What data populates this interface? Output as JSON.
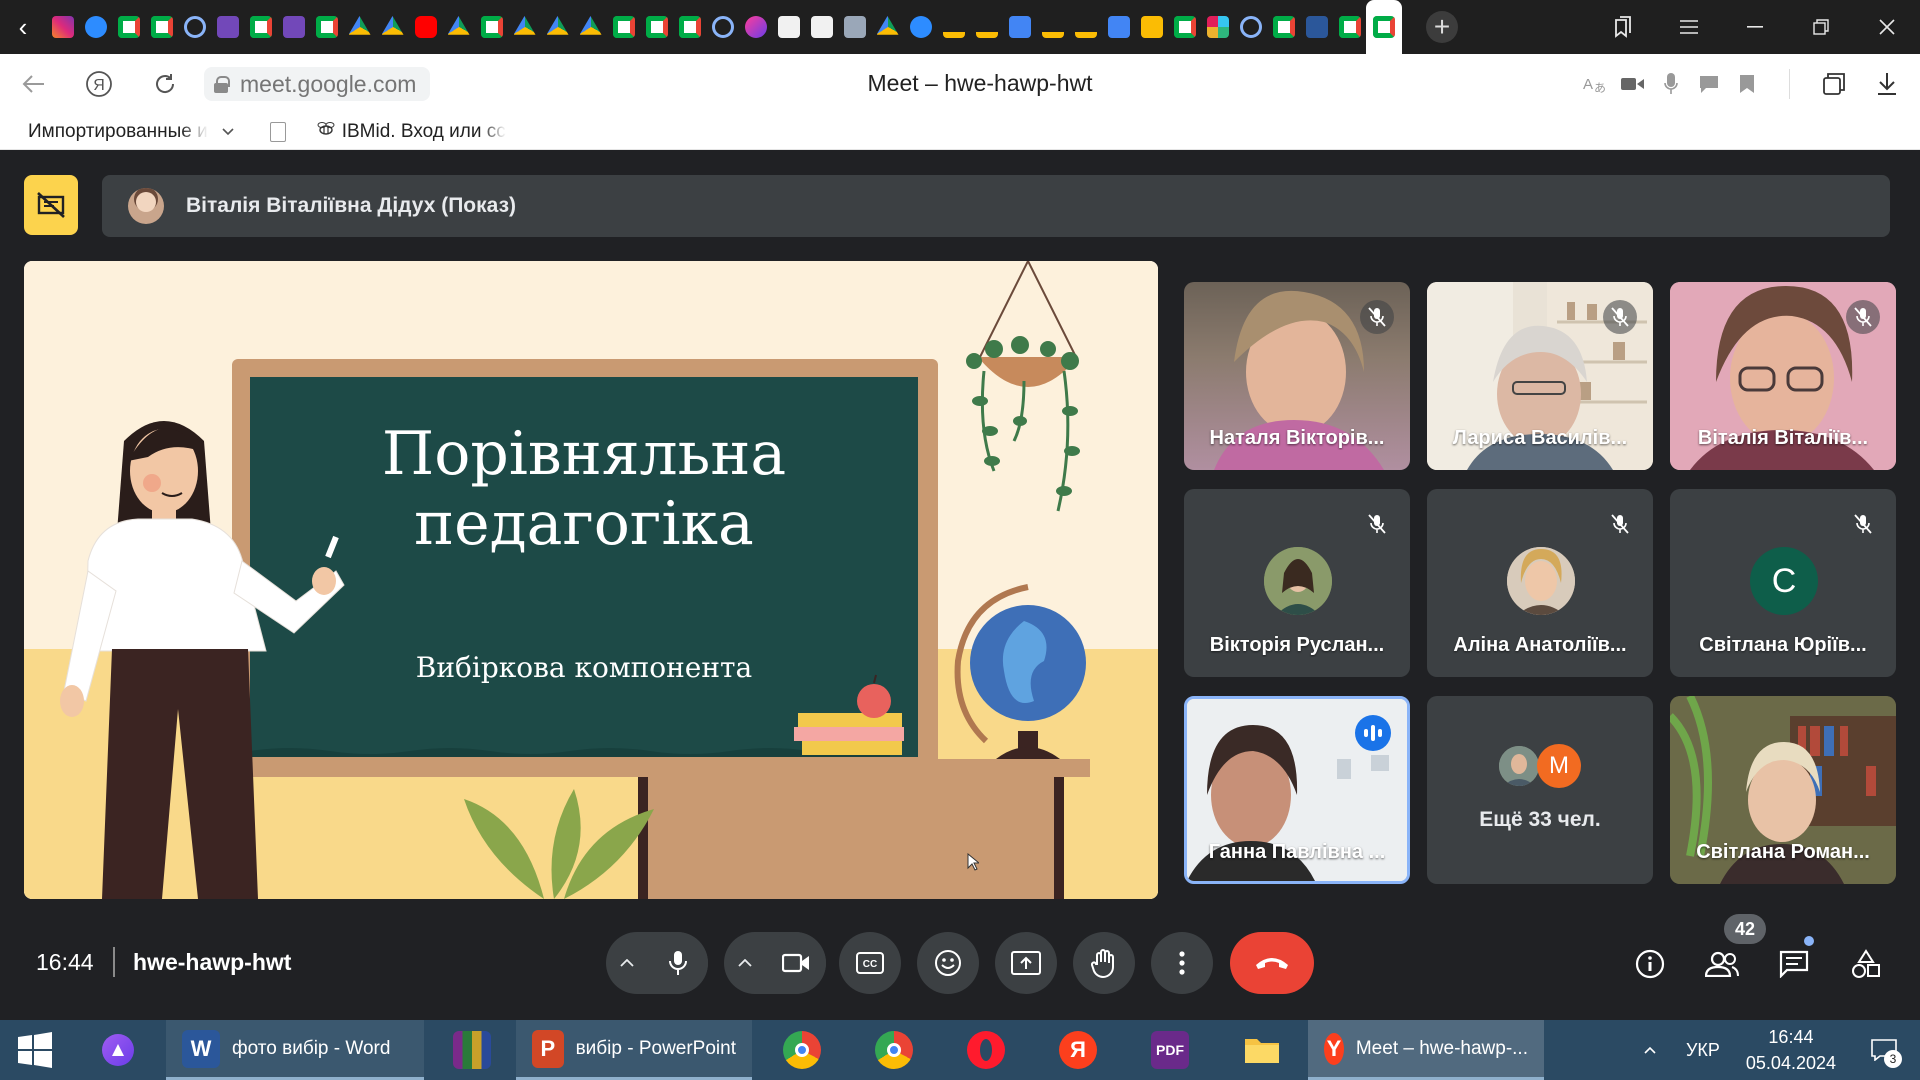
{
  "browser": {
    "url": "meet.google.com",
    "page_title": "Meet – hwe-hawp-hwt",
    "favicon_icons": [
      "instagram-icon",
      "zoom-icon",
      "meet-icon",
      "meet-icon",
      "link-icon",
      "forms-icon",
      "meet-icon",
      "forms-icon",
      "meet-icon",
      "drive-icon",
      "drive-icon",
      "youtube-icon",
      "drive-icon",
      "meet-icon",
      "drive-icon",
      "drive-icon",
      "drive-icon",
      "meet-icon",
      "meet-icon",
      "meet-icon",
      "link-icon",
      "arc-icon",
      "doc-icon",
      "doc-icon",
      "image-icon",
      "drive-icon",
      "zoom-icon",
      "classroom-icon",
      "classroom-icon",
      "docs-icon",
      "classroom-icon",
      "classroom-icon",
      "docs-icon",
      "slides-icon",
      "meet-icon",
      "slack-icon",
      "link-icon",
      "meet-icon",
      "word-icon",
      "meet-icon",
      "meet-icon"
    ],
    "bookmarks": [
      {
        "label": "Импортированные и"
      },
      {
        "label": "IBMid. Вход или сс"
      }
    ]
  },
  "meet": {
    "presenter_label": "Віталія Віталіївна Дідух (Показ)",
    "slide": {
      "title_line1": "Порівняльна",
      "title_line2": "педагогіка",
      "subtitle": "Вибіркова компонента"
    },
    "participants": [
      {
        "name": "Наталя Вікторів...",
        "muted": true
      },
      {
        "name": "Лариса Василів...",
        "muted": true
      },
      {
        "name": "Віталія Віталіїв...",
        "muted": true
      },
      {
        "name": "Вікторія Руслан...",
        "muted": true
      },
      {
        "name": "Аліна Анатоліїв...",
        "muted": true
      },
      {
        "name": "Світлана Юріїв...",
        "muted": true,
        "initial": "С"
      },
      {
        "name": "Ганна Павлівна ...",
        "speaking": true
      },
      {
        "more_label": "Ещё 33 чел.",
        "initial": "М"
      },
      {
        "name": "Світлана Роман..."
      }
    ],
    "time": "16:44",
    "meeting_code": "hwe-hawp-hwt",
    "participant_count": "42"
  },
  "taskbar": {
    "apps": [
      {
        "label": "фото вибір - Word"
      },
      {
        "label": "вибір - PowerPoint"
      },
      {
        "label": "Meet – hwe-hawp-..."
      }
    ],
    "lang": "УКР",
    "time": "16:44",
    "date": "05.04.2024",
    "notifications": "3"
  },
  "colors": {
    "meet_bg": "#202124",
    "tile_bg": "#3c4043",
    "hangup": "#ea4335",
    "presenter_badge": "#fcd34d",
    "chalkboard": "#1d4a47",
    "accent_blue": "#1a73e8"
  }
}
